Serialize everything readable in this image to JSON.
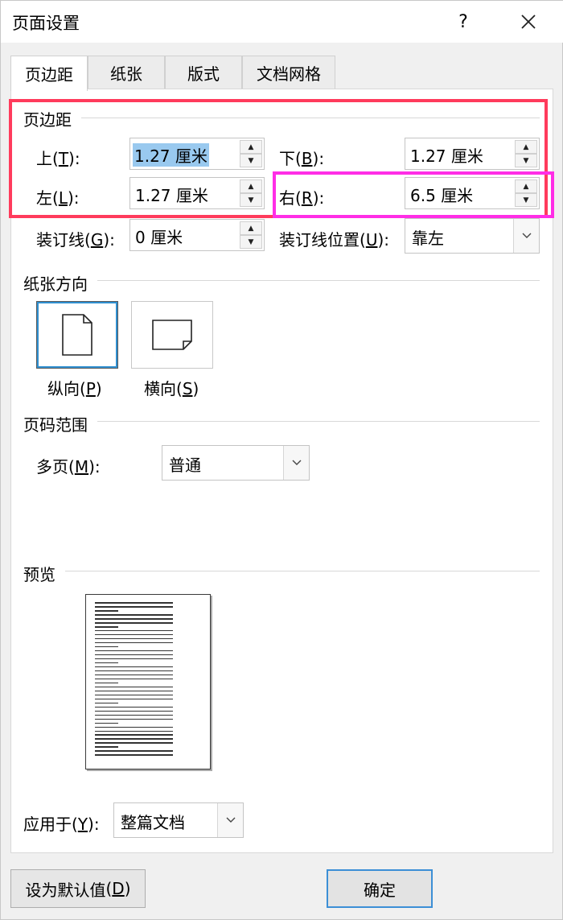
{
  "window": {
    "title": "页面设置",
    "help": "?",
    "close": "✕"
  },
  "tabs": [
    "页边距",
    "纸张",
    "版式",
    "文档网格"
  ],
  "margins": {
    "section_title": "页边距",
    "top": {
      "label": "上",
      "key": "T",
      "value": "1.27 厘米"
    },
    "bottom": {
      "label": "下",
      "key": "B",
      "value": "1.27 厘米"
    },
    "left": {
      "label": "左",
      "key": "L",
      "value": "1.27 厘米"
    },
    "right": {
      "label": "右",
      "key": "R",
      "value": "6.5 厘米"
    },
    "gutter": {
      "label": "装订线",
      "key": "G",
      "value": "0 厘米"
    },
    "gutter_position": {
      "label": "装订线位置",
      "key": "U",
      "value": "靠左"
    }
  },
  "orientation": {
    "section_title": "纸张方向",
    "portrait": {
      "label": "纵向",
      "key": "P"
    },
    "landscape": {
      "label": "横向",
      "key": "S"
    }
  },
  "pages": {
    "section_title": "页码范围",
    "multiple": {
      "label": "多页",
      "key": "M",
      "value": "普通"
    }
  },
  "preview": {
    "section_title": "预览"
  },
  "apply_to": {
    "label": "应用于",
    "key": "Y",
    "value": "整篇文档"
  },
  "buttons": {
    "default": {
      "label": "设为默认值",
      "key": "D"
    },
    "ok": "确定"
  }
}
